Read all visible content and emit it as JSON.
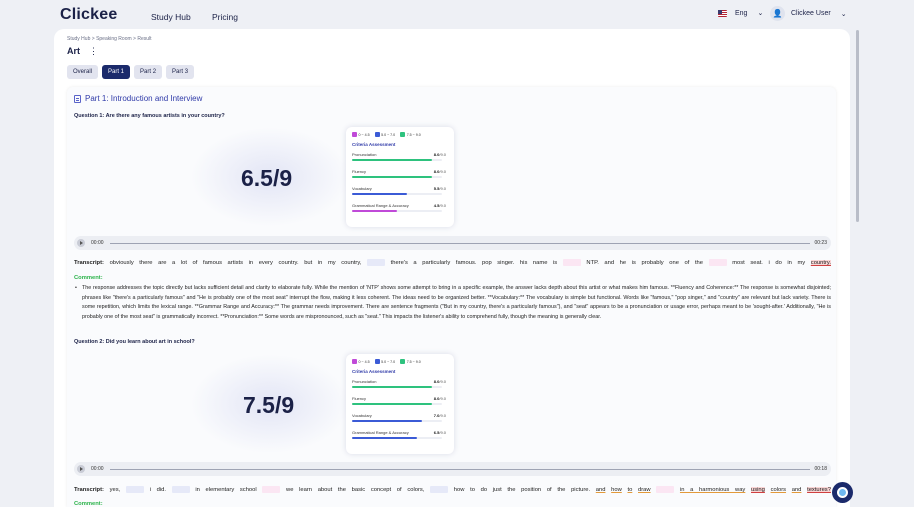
{
  "header": {
    "logo": "Clickee",
    "nav": [
      "Study Hub",
      "Pricing"
    ],
    "language": "Eng",
    "user": "Clickee User"
  },
  "breadcrumb": [
    "Study Hub",
    "Speaking Room",
    "Result"
  ],
  "page_title": "Art",
  "tabs": [
    {
      "label": "Overall",
      "active": false
    },
    {
      "label": "Part 1",
      "active": true
    },
    {
      "label": "Part 2",
      "active": false
    },
    {
      "label": "Part 3",
      "active": false
    }
  ],
  "section_title": "Part 1: Introduction and Interview",
  "legend": [
    "0 ~ 4.5",
    "5.0 ~ 7.0",
    "7.5 ~ 9.0"
  ],
  "legend_colors": [
    "#c04ad8",
    "#3b5bd6",
    "#2ec27e"
  ],
  "criteria_header": "Criteria Assessment",
  "questions": [
    {
      "question": "Question 1: Are there any famous artists in your country?",
      "score": "6.5/9",
      "criteria": [
        {
          "name": "Pronunciation",
          "score": "8.0",
          "max": "/9.0",
          "value": 8.0,
          "color": "#2ec27e"
        },
        {
          "name": "Fluency",
          "score": "8.0",
          "max": "/9.0",
          "value": 8.0,
          "color": "#2ec27e"
        },
        {
          "name": "Vocabulary",
          "score": "5.5",
          "max": "/9.0",
          "value": 5.5,
          "color": "#3b5bd6"
        },
        {
          "name": "Grammatical Range & Accuracy",
          "score": "4.5",
          "max": "/9.0",
          "value": 4.5,
          "color": "#c04ad8"
        }
      ],
      "audio_start": "00:00",
      "audio_end": "00:23",
      "transcript_label": "Transcript:",
      "transcript_parts": [
        "obviously there are a lot of famous artists in every country. but in my country,",
        "there's a particularly famous. pop singer. his name is",
        "NTP. and he is probably one of the",
        "most seat. i do in my",
        "country."
      ],
      "comment_label": "Comment:",
      "comment": "The response addresses the topic directly but lacks sufficient detail and clarity to elaborate fully. While the mention of 'NTP' shows some attempt to bring in a specific example, the answer lacks depth about this artist or what makes him famous. **Fluency and Coherence:** The response is somewhat disjointed; phrases like \"there's a particularly famous\" and \"He is probably one of the most seat\" interrupt the flow, making it less coherent. The ideas need to be organized better. **Vocabulary:** The vocabulary is simple but functional. Words like \"famous,\" \"pop singer,\" and \"country\" are relevant but lack variety. There is some repetition, which limits the lexical range. **Grammar Range and Accuracy:** The grammar needs improvement. There are sentence fragments (\"But in my country, there's a particularly famous\"), and \"seat\" appears to be a pronunciation or usage error, perhaps meant to be 'sought-after.' Additionally, \"He is probably one of the most seat\" is grammatically incorrect. **Pronunciation:** Some words are mispronounced, such as \"seat.\" This impacts the listener's ability to comprehend fully, though the meaning is generally clear."
    },
    {
      "question": "Question 2: Did you learn about art in school?",
      "score": "7.5/9",
      "criteria": [
        {
          "name": "Pronunciation",
          "score": "8.0",
          "max": "/9.0",
          "value": 8.0,
          "color": "#2ec27e"
        },
        {
          "name": "Fluency",
          "score": "8.0",
          "max": "/9.0",
          "value": 8.0,
          "color": "#2ec27e"
        },
        {
          "name": "Vocabulary",
          "score": "7.0",
          "max": "/9.0",
          "value": 7.0,
          "color": "#3b5bd6"
        },
        {
          "name": "Grammatical Range & Accuracy",
          "score": "6.5",
          "max": "/9.0",
          "value": 6.5,
          "color": "#3b5bd6"
        }
      ],
      "audio_start": "00:00",
      "audio_end": "00:18",
      "transcript_label": "Transcript:",
      "transcript_parts": [
        "yes,",
        "i did.",
        "in elementary school",
        "we learn about the basic concept of colors,",
        "how to do just the position of the picture.",
        "and",
        "how",
        "to",
        "draw",
        "in a harmonious way",
        "using",
        "colors",
        "and",
        "textures?"
      ],
      "comment_label": "Comment:"
    }
  ]
}
